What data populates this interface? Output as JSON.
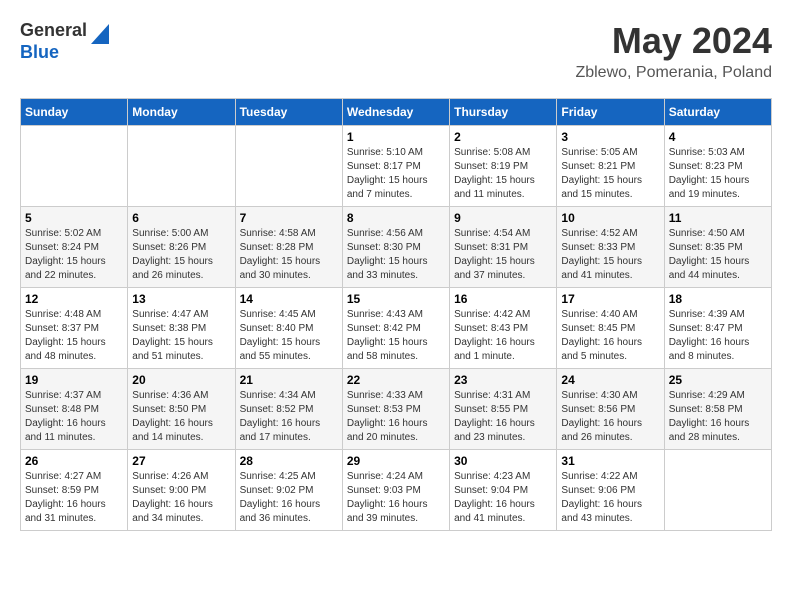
{
  "header": {
    "logo_line1": "General",
    "logo_line2": "Blue",
    "month_title": "May 2024",
    "location": "Zblewo, Pomerania, Poland"
  },
  "days_of_week": [
    "Sunday",
    "Monday",
    "Tuesday",
    "Wednesday",
    "Thursday",
    "Friday",
    "Saturday"
  ],
  "weeks": [
    [
      {
        "day": "",
        "sunrise": "",
        "sunset": "",
        "daylight": ""
      },
      {
        "day": "",
        "sunrise": "",
        "sunset": "",
        "daylight": ""
      },
      {
        "day": "",
        "sunrise": "",
        "sunset": "",
        "daylight": ""
      },
      {
        "day": "1",
        "sunrise": "5:10 AM",
        "sunset": "8:17 PM",
        "daylight": "15 hours and 7 minutes."
      },
      {
        "day": "2",
        "sunrise": "5:08 AM",
        "sunset": "8:19 PM",
        "daylight": "15 hours and 11 minutes."
      },
      {
        "day": "3",
        "sunrise": "5:05 AM",
        "sunset": "8:21 PM",
        "daylight": "15 hours and 15 minutes."
      },
      {
        "day": "4",
        "sunrise": "5:03 AM",
        "sunset": "8:23 PM",
        "daylight": "15 hours and 19 minutes."
      }
    ],
    [
      {
        "day": "5",
        "sunrise": "5:02 AM",
        "sunset": "8:24 PM",
        "daylight": "15 hours and 22 minutes."
      },
      {
        "day": "6",
        "sunrise": "5:00 AM",
        "sunset": "8:26 PM",
        "daylight": "15 hours and 26 minutes."
      },
      {
        "day": "7",
        "sunrise": "4:58 AM",
        "sunset": "8:28 PM",
        "daylight": "15 hours and 30 minutes."
      },
      {
        "day": "8",
        "sunrise": "4:56 AM",
        "sunset": "8:30 PM",
        "daylight": "15 hours and 33 minutes."
      },
      {
        "day": "9",
        "sunrise": "4:54 AM",
        "sunset": "8:31 PM",
        "daylight": "15 hours and 37 minutes."
      },
      {
        "day": "10",
        "sunrise": "4:52 AM",
        "sunset": "8:33 PM",
        "daylight": "15 hours and 41 minutes."
      },
      {
        "day": "11",
        "sunrise": "4:50 AM",
        "sunset": "8:35 PM",
        "daylight": "15 hours and 44 minutes."
      }
    ],
    [
      {
        "day": "12",
        "sunrise": "4:48 AM",
        "sunset": "8:37 PM",
        "daylight": "15 hours and 48 minutes."
      },
      {
        "day": "13",
        "sunrise": "4:47 AM",
        "sunset": "8:38 PM",
        "daylight": "15 hours and 51 minutes."
      },
      {
        "day": "14",
        "sunrise": "4:45 AM",
        "sunset": "8:40 PM",
        "daylight": "15 hours and 55 minutes."
      },
      {
        "day": "15",
        "sunrise": "4:43 AM",
        "sunset": "8:42 PM",
        "daylight": "15 hours and 58 minutes."
      },
      {
        "day": "16",
        "sunrise": "4:42 AM",
        "sunset": "8:43 PM",
        "daylight": "16 hours and 1 minute."
      },
      {
        "day": "17",
        "sunrise": "4:40 AM",
        "sunset": "8:45 PM",
        "daylight": "16 hours and 5 minutes."
      },
      {
        "day": "18",
        "sunrise": "4:39 AM",
        "sunset": "8:47 PM",
        "daylight": "16 hours and 8 minutes."
      }
    ],
    [
      {
        "day": "19",
        "sunrise": "4:37 AM",
        "sunset": "8:48 PM",
        "daylight": "16 hours and 11 minutes."
      },
      {
        "day": "20",
        "sunrise": "4:36 AM",
        "sunset": "8:50 PM",
        "daylight": "16 hours and 14 minutes."
      },
      {
        "day": "21",
        "sunrise": "4:34 AM",
        "sunset": "8:52 PM",
        "daylight": "16 hours and 17 minutes."
      },
      {
        "day": "22",
        "sunrise": "4:33 AM",
        "sunset": "8:53 PM",
        "daylight": "16 hours and 20 minutes."
      },
      {
        "day": "23",
        "sunrise": "4:31 AM",
        "sunset": "8:55 PM",
        "daylight": "16 hours and 23 minutes."
      },
      {
        "day": "24",
        "sunrise": "4:30 AM",
        "sunset": "8:56 PM",
        "daylight": "16 hours and 26 minutes."
      },
      {
        "day": "25",
        "sunrise": "4:29 AM",
        "sunset": "8:58 PM",
        "daylight": "16 hours and 28 minutes."
      }
    ],
    [
      {
        "day": "26",
        "sunrise": "4:27 AM",
        "sunset": "8:59 PM",
        "daylight": "16 hours and 31 minutes."
      },
      {
        "day": "27",
        "sunrise": "4:26 AM",
        "sunset": "9:00 PM",
        "daylight": "16 hours and 34 minutes."
      },
      {
        "day": "28",
        "sunrise": "4:25 AM",
        "sunset": "9:02 PM",
        "daylight": "16 hours and 36 minutes."
      },
      {
        "day": "29",
        "sunrise": "4:24 AM",
        "sunset": "9:03 PM",
        "daylight": "16 hours and 39 minutes."
      },
      {
        "day": "30",
        "sunrise": "4:23 AM",
        "sunset": "9:04 PM",
        "daylight": "16 hours and 41 minutes."
      },
      {
        "day": "31",
        "sunrise": "4:22 AM",
        "sunset": "9:06 PM",
        "daylight": "16 hours and 43 minutes."
      },
      {
        "day": "",
        "sunrise": "",
        "sunset": "",
        "daylight": ""
      }
    ]
  ]
}
